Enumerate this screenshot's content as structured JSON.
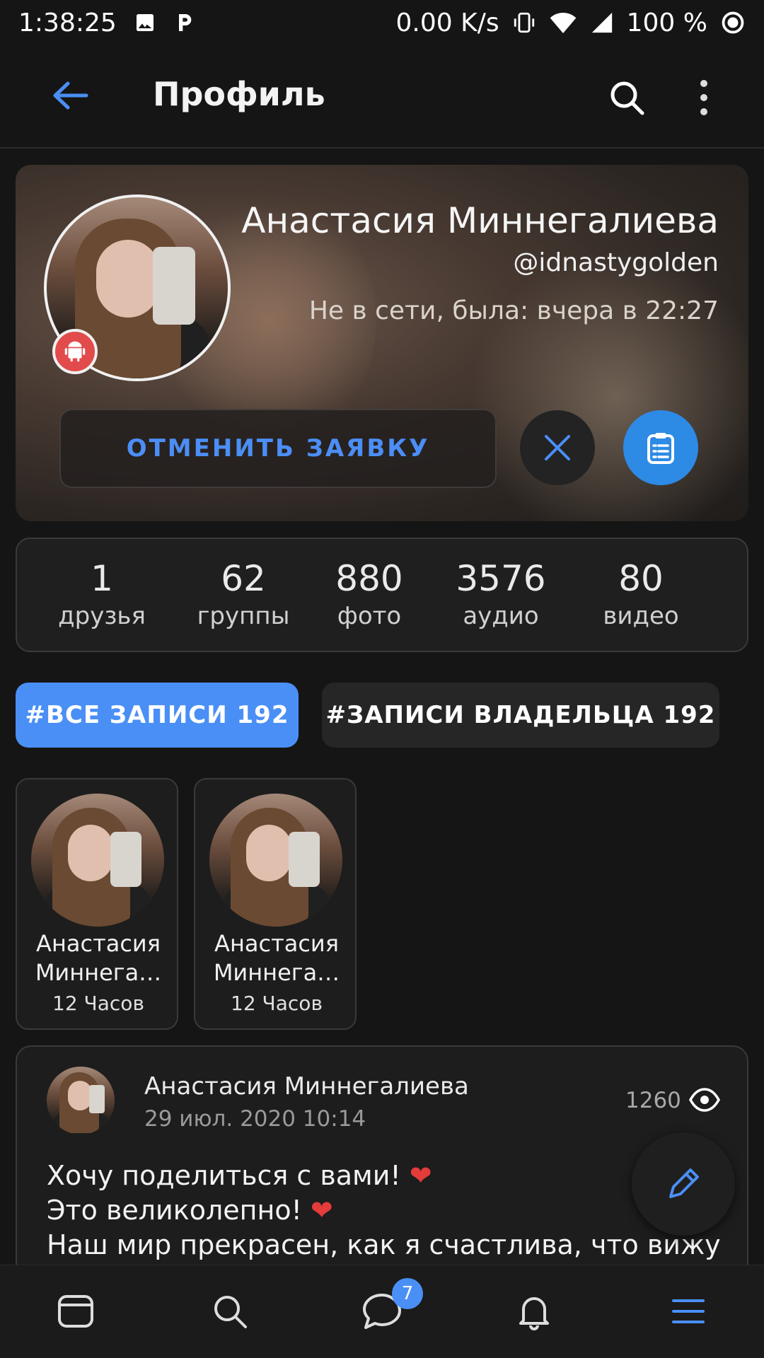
{
  "status_bar": {
    "time": "1:38:25",
    "net_speed": "0.00 K/s",
    "battery": "100 %"
  },
  "appbar": {
    "title": "Профиль"
  },
  "profile": {
    "name": "Анастасия Миннегалиева",
    "handle": "@idnastygolden",
    "status": "Не в сети, была: вчера в 22:27",
    "cancel_button": "ОТМЕНИТЬ ЗАЯВКУ"
  },
  "stats": [
    {
      "value": "1",
      "label": "друзья"
    },
    {
      "value": "62",
      "label": "группы"
    },
    {
      "value": "880",
      "label": "фото"
    },
    {
      "value": "3576",
      "label": "аудио"
    },
    {
      "value": "80",
      "label": "видео"
    }
  ],
  "tabs": {
    "all": "#ВСЕ ЗАПИСИ 192",
    "owner": "#ЗАПИСИ ВЛАДЕЛЬЦА 192"
  },
  "stories": [
    {
      "name_line1": "Анастасия",
      "name_line2": "Миннега…",
      "time": "12 Часов"
    },
    {
      "name_line1": "Анастасия",
      "name_line2": "Миннега…",
      "time": "12 Часов"
    }
  ],
  "post": {
    "author": "Анастасия Миннегалиева",
    "date": "29 июл. 2020 10:14",
    "views": "1260",
    "line1": "Хочу поделиться с вами!",
    "line2": "Это великолепно!",
    "line3": "Наш мир прекрасен, как я счастлива, что вижу"
  },
  "bottom_nav": {
    "messages_badge": "7"
  },
  "colors": {
    "accent": "#4a8ff5",
    "fab_blue": "#2d8be5",
    "android_red": "#e24b4b",
    "heart_red": "#e43b3b"
  },
  "icons": [
    "back-arrow-icon",
    "search-icon",
    "more-vert-icon",
    "android-icon",
    "close-icon",
    "notes-icon",
    "eye-icon",
    "pencil-icon",
    "news-icon",
    "messages-icon",
    "bell-icon",
    "menu-icon"
  ]
}
